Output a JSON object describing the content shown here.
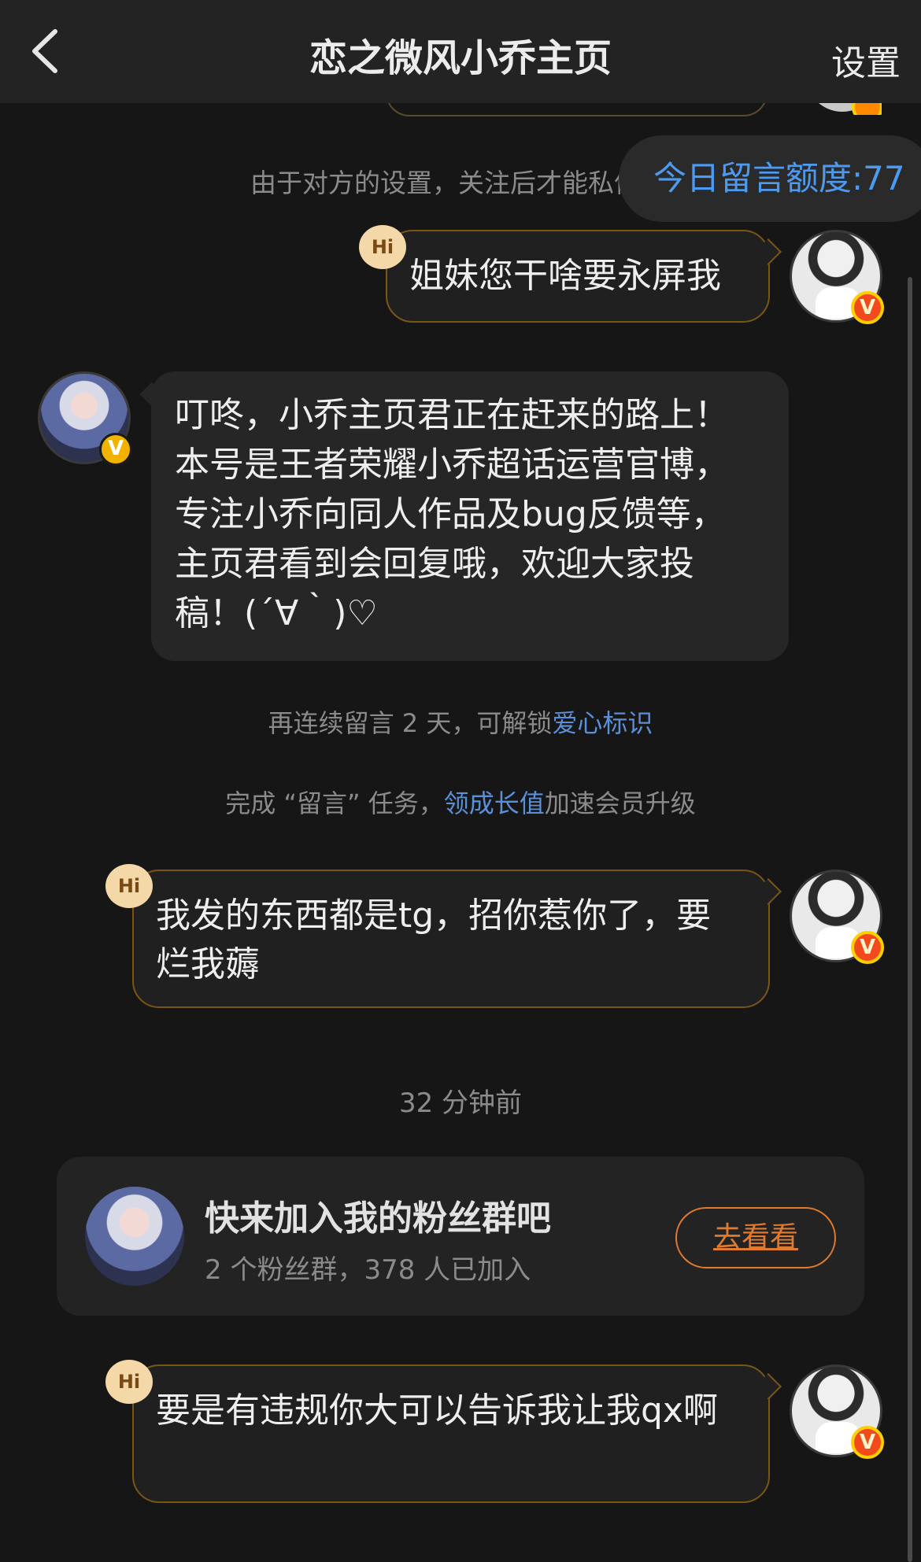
{
  "header": {
    "title": "恋之微风小乔主页",
    "settings_label": "设置",
    "back_icon": "chevron-left-icon"
  },
  "notice": {
    "text": "由于对方的设置，关注后才能私信",
    "quota_label": "今日留言额度:77"
  },
  "messages": [
    {
      "sender": "me",
      "tag": "Hi",
      "text": "姐妹您干啥要永屏我",
      "badge": "V"
    },
    {
      "sender": "other",
      "text": "叮咚，小乔主页君正在赶来的路上！本号是王者荣耀小乔超话运营官博，专注小乔向同人作品及bug反馈等，主页君看到会回复哦，欢迎大家投稿！(´∀｀)♡",
      "badge": "V"
    },
    {
      "sender": "me",
      "tag": "Hi",
      "text": "我发的东西都是tg，招你惹你了，要烂我薅",
      "badge": "V"
    },
    {
      "sender": "me",
      "tag": "Hi",
      "text": "要是有违规你大可以告诉我让我qx啊",
      "badge": "V"
    }
  ],
  "system": {
    "streak_prefix": "再连续留言 2 天，可解锁",
    "streak_link": "爱心标识",
    "task_prefix": "完成 “留言” 任务，",
    "task_link": "领成长值",
    "task_suffix": "加速会员升级",
    "timestamp": "32 分钟前"
  },
  "fan_group": {
    "title": "快来加入我的粉丝群吧",
    "subtitle": "2 个粉丝群，378 人已加入",
    "button_label": "去看看"
  },
  "colors": {
    "background": "#161616",
    "quota_blue": "#4d9bf0",
    "link_blue": "#5b8fd8",
    "bubble_border": "#7a5517",
    "button_orange": "#e07a2e",
    "verify_badge_red": "#f24a1c",
    "verify_badge_gold": "#f2b300"
  }
}
